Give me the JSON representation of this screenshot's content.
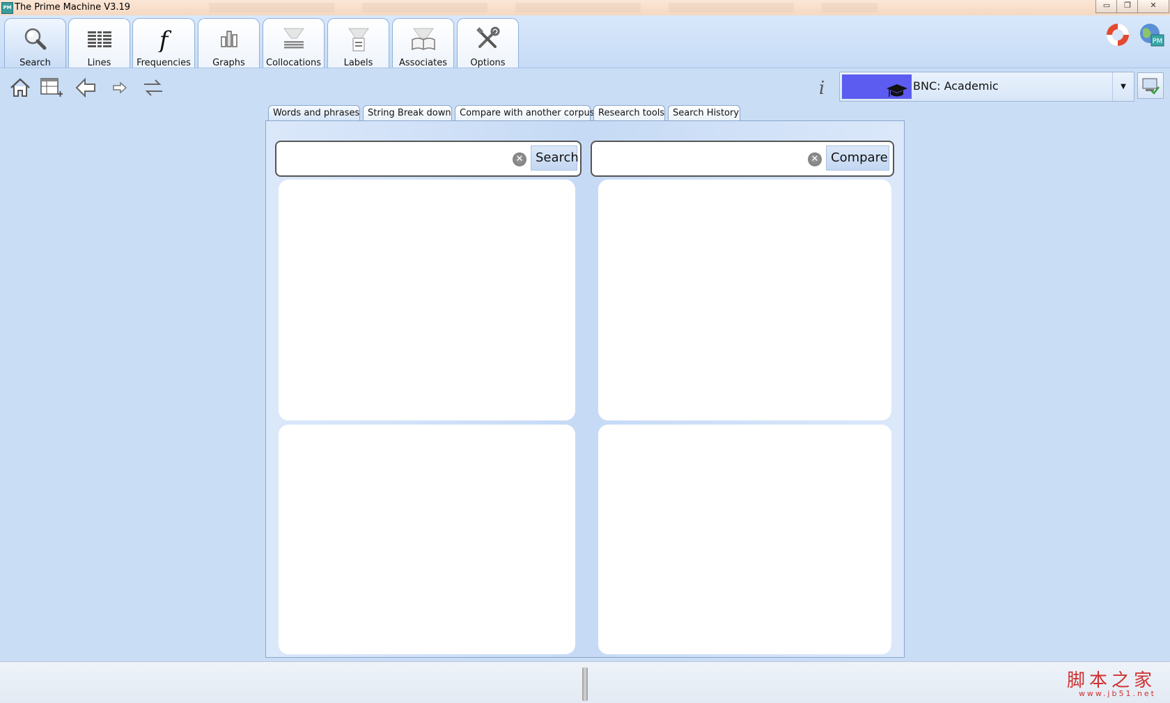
{
  "window": {
    "title": "The Prime Machine V3.19",
    "app_icon_text": "PM",
    "minimize_glyph": "▭",
    "restore_glyph": "❐",
    "close_glyph": "✕"
  },
  "toolbar": {
    "tabs": [
      {
        "label": "Search",
        "icon": "magnifier-icon"
      },
      {
        "label": "Lines",
        "icon": "lines-icon"
      },
      {
        "label": "Frequencies",
        "icon": "function-f-icon"
      },
      {
        "label": "Graphs",
        "icon": "bar-graph-icon"
      },
      {
        "label": "Collocations",
        "icon": "collocation-cloud-icon"
      },
      {
        "label": "Labels",
        "icon": "labels-icon"
      },
      {
        "label": "Associates",
        "icon": "associates-book-icon"
      },
      {
        "label": "Options",
        "icon": "tools-icon"
      }
    ],
    "active": "Search"
  },
  "nav": {
    "icons": [
      "home-icon",
      "add-table-icon",
      "back-arrow-icon",
      "forward-arrow-icon",
      "swap-arrows-icon"
    ],
    "info_glyph": "i"
  },
  "corpus": {
    "selected": "BNC: Academic",
    "dropdown_glyph": "▼",
    "swatch_color": "#5c5cf0"
  },
  "tabs": [
    {
      "label": "Words and phrases",
      "active": true
    },
    {
      "label": "String Break down",
      "active": false
    },
    {
      "label": "Compare with another corpus",
      "active": false
    },
    {
      "label": "Research tools",
      "active": false
    },
    {
      "label": "Search History",
      "active": false
    }
  ],
  "search": {
    "left": {
      "value": "",
      "placeholder": "",
      "button": "Search",
      "clear_glyph": "✕"
    },
    "right": {
      "value": "",
      "placeholder": "",
      "button": "Compare",
      "clear_glyph": "✕"
    }
  },
  "watermark": {
    "main": "脚本之家",
    "sub": "www.jb51.net"
  }
}
